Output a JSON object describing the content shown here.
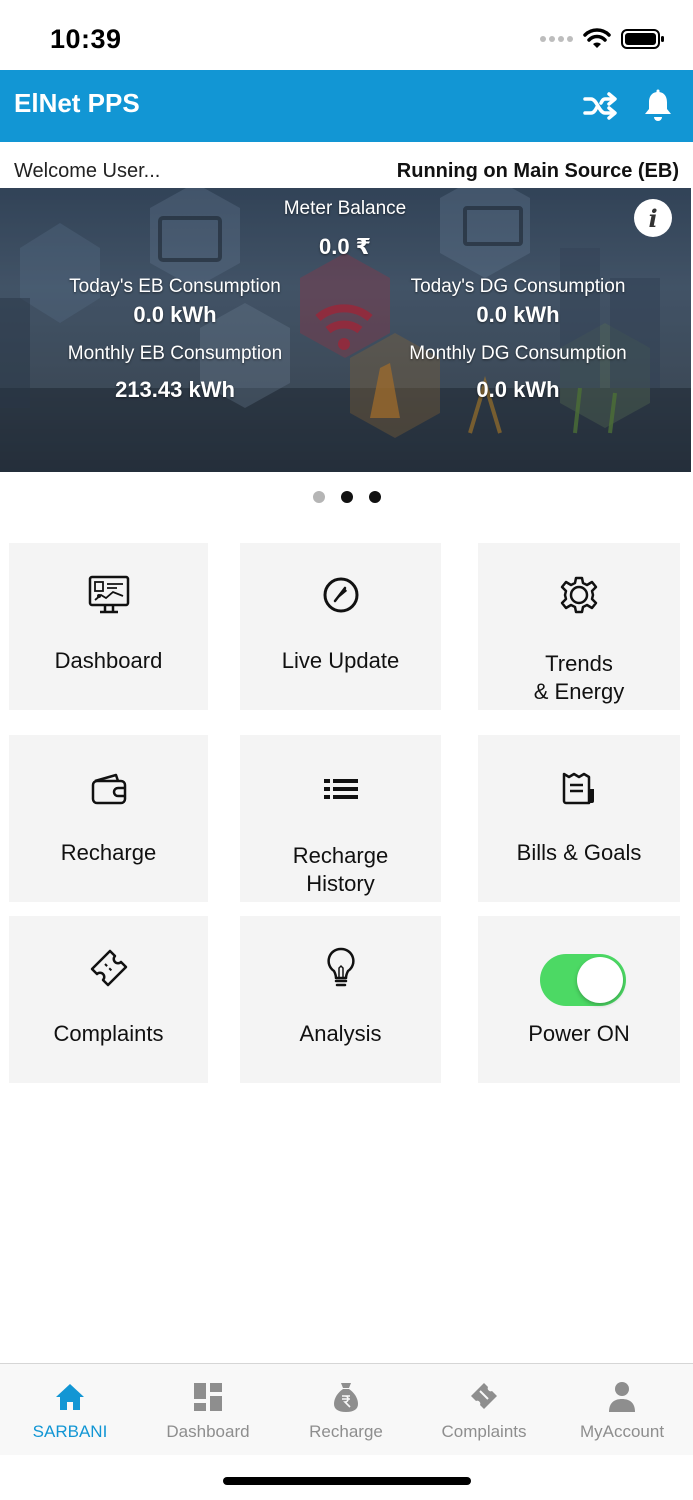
{
  "status_bar": {
    "time": "10:39",
    "icons": [
      "signal-icon",
      "wifi-icon",
      "battery-icon"
    ]
  },
  "header": {
    "title": "ElNet PPS",
    "icons": [
      "shuffle-icon",
      "bell-icon"
    ],
    "color": "#1296d4"
  },
  "welcome": {
    "greeting": "Welcome User...",
    "source": "Running on Main Source (EB)"
  },
  "banner": {
    "meter_balance_label": "Meter Balance",
    "meter_balance_value": "0.0 ₹",
    "today_eb_label": "Today's EB Consumption",
    "today_eb_value": "0.0 kWh",
    "today_dg_label": "Today's DG Consumption",
    "today_dg_value": "0.0 kWh",
    "monthly_eb_label": "Monthly EB Consumption",
    "monthly_eb_value": "213.43 kWh",
    "monthly_dg_label": "Monthly DG Consumption",
    "monthly_dg_value": "0.0 kWh",
    "info_icon": "info-icon"
  },
  "pager": {
    "count": 3,
    "active_index": 0
  },
  "tiles": [
    {
      "label": "Dashboard",
      "icon": "monitor-dashboard-icon"
    },
    {
      "label": "Live Update",
      "icon": "gauge-icon"
    },
    {
      "label_line1": "Trends",
      "label_line2": "& Energy",
      "icon": "gear-icon"
    },
    {
      "label": "Recharge",
      "icon": "wallet-icon"
    },
    {
      "label_line1": "Recharge",
      "label_line2": "History",
      "icon": "list-icon"
    },
    {
      "label": "Bills & Goals",
      "icon": "receipt-icon"
    },
    {
      "label": "Complaints",
      "icon": "ticket-icon"
    },
    {
      "label": "Analysis",
      "icon": "lightbulb-icon"
    },
    {
      "label": "Power ON",
      "toggle_on": true,
      "toggle_color": "#4cd964"
    }
  ],
  "tab_bar": {
    "active_color": "#1296d4",
    "items": [
      {
        "label": "SARBANI",
        "icon": "home-icon",
        "active": true
      },
      {
        "label": "Dashboard",
        "icon": "dashboard-icon",
        "active": false
      },
      {
        "label": "Recharge",
        "icon": "rupee-bag-icon",
        "active": false
      },
      {
        "label": "Complaints",
        "icon": "ticket-icon",
        "active": false
      },
      {
        "label": "MyAccount",
        "icon": "person-icon",
        "active": false
      }
    ]
  }
}
